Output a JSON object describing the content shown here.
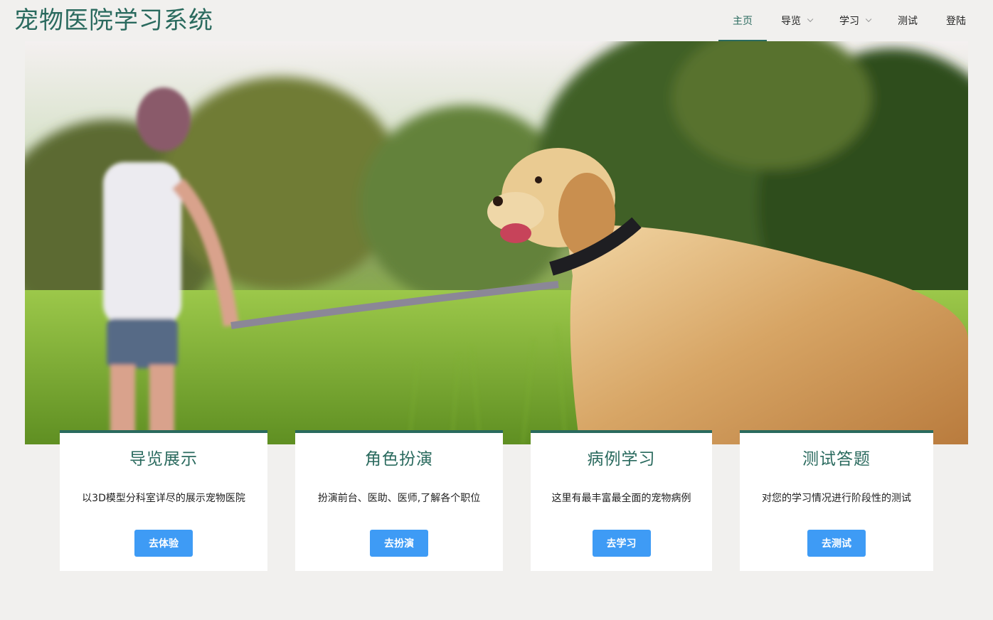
{
  "header": {
    "title": "宠物医院学习系统"
  },
  "nav": {
    "items": [
      {
        "label": "主页",
        "active": true,
        "dropdown": false
      },
      {
        "label": "导览",
        "active": false,
        "dropdown": true
      },
      {
        "label": "学习",
        "active": false,
        "dropdown": true
      },
      {
        "label": "测试",
        "active": false,
        "dropdown": false
      },
      {
        "label": "登陆",
        "active": false,
        "dropdown": false
      }
    ]
  },
  "cards": [
    {
      "title": "导览展示",
      "description": "以3D模型分科室详尽的展示宠物医院",
      "button": "去体验"
    },
    {
      "title": "角色扮演",
      "description": "扮演前台、医助、医师,了解各个职位",
      "button": "去扮演"
    },
    {
      "title": "病例学习",
      "description": "这里有最丰富最全面的宠物病例",
      "button": "去学习"
    },
    {
      "title": "测试答题",
      "description": "对您的学习情况进行阶段性的测试",
      "button": "去测试"
    }
  ],
  "colors": {
    "accent": "#2a6a5e",
    "button": "#3e9bf5",
    "background": "#f1f0ee"
  }
}
